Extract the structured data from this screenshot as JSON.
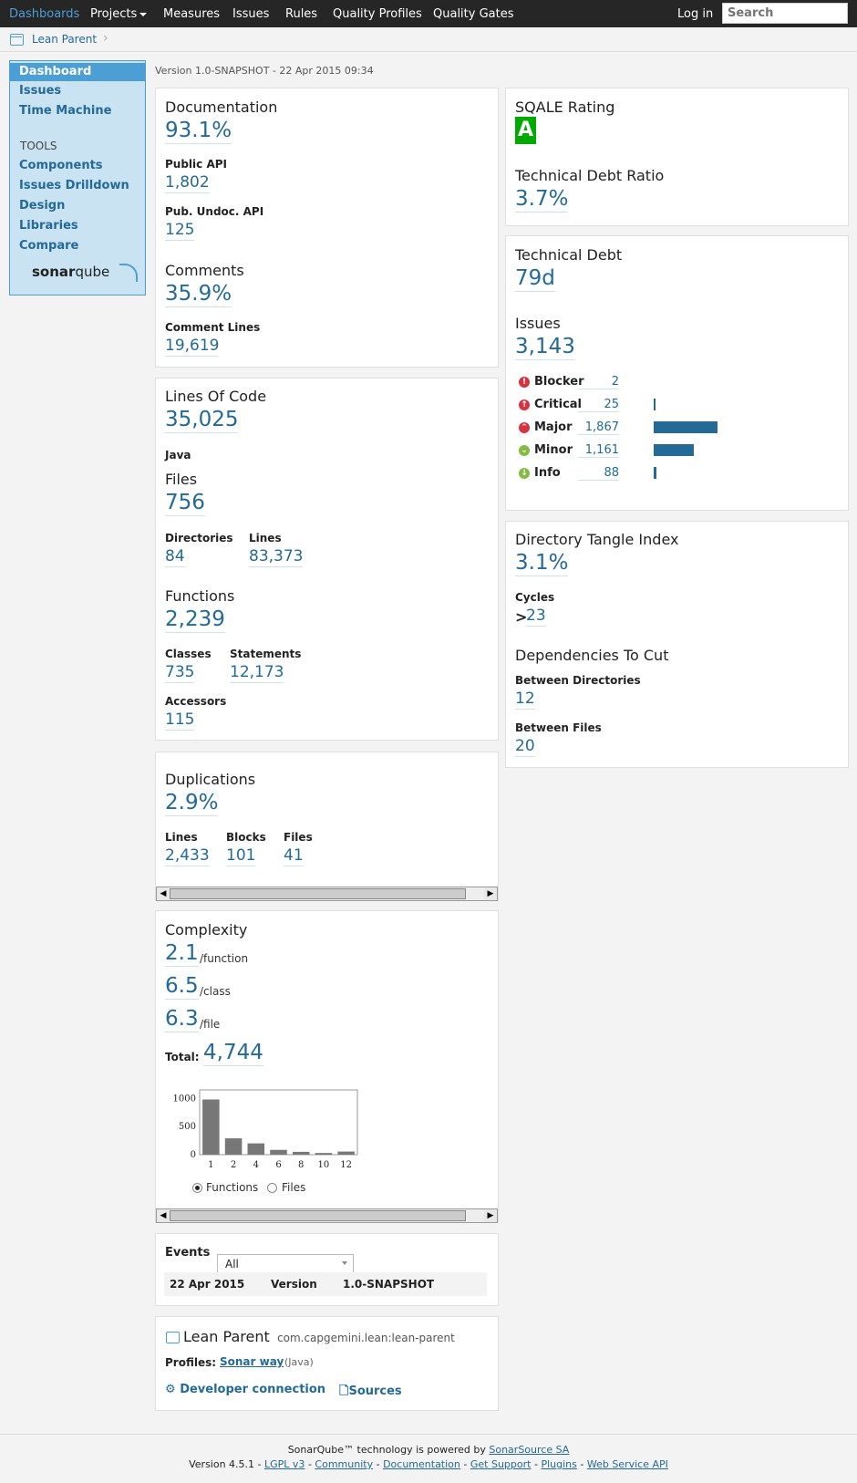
{
  "nav": {
    "dashboards": "Dashboards",
    "projects": "Projects",
    "measures": "Measures",
    "issues": "Issues",
    "rules": "Rules",
    "quality_profiles": "Quality Profiles",
    "quality_gates": "Quality Gates",
    "login": "Log in",
    "search_placeholder": "Search"
  },
  "breadcrumb": {
    "project": "Lean Parent"
  },
  "sidebar": {
    "dashboard": "Dashboard",
    "issues": "Issues",
    "time_machine": "Time Machine",
    "tools_heading": "TOOLS",
    "components": "Components",
    "issues_drilldown": "Issues Drilldown",
    "design": "Design",
    "libraries": "Libraries",
    "compare": "Compare",
    "logo_bold": "sonar",
    "logo_light": "qube"
  },
  "version_line": "Version 1.0-SNAPSHOT - 22 Apr 2015 09:34",
  "documentation": {
    "title": "Documentation",
    "value": "93.1%",
    "public_api_label": "Public API",
    "public_api": "1,802",
    "undoc_label": "Pub. Undoc. API",
    "undoc": "125",
    "comments_title": "Comments",
    "comments": "35.9%",
    "comment_lines_label": "Comment Lines",
    "comment_lines": "19,619"
  },
  "size": {
    "loc_title": "Lines Of Code",
    "loc": "35,025",
    "language": "Java",
    "files_title": "Files",
    "files": "756",
    "directories_label": "Directories",
    "directories": "84",
    "lines_label": "Lines",
    "lines": "83,373",
    "functions_title": "Functions",
    "functions": "2,239",
    "classes_label": "Classes",
    "classes": "735",
    "statements_label": "Statements",
    "statements": "12,173",
    "accessors_label": "Accessors",
    "accessors": "115"
  },
  "duplications": {
    "title": "Duplications",
    "value": "2.9%",
    "lines_label": "Lines",
    "lines": "2,433",
    "blocks_label": "Blocks",
    "blocks": "101",
    "files_label": "Files",
    "files": "41"
  },
  "complexity": {
    "title": "Complexity",
    "per_function": "2.1",
    "per_function_unit": "/function",
    "per_class": "6.5",
    "per_class_unit": "/class",
    "per_file": "6.3",
    "per_file_unit": "/file",
    "total_label": "Total:",
    "total": "4,744",
    "radio_functions": "Functions",
    "radio_files": "Files",
    "selected": "Functions"
  },
  "chart_data": {
    "type": "bar",
    "categories": [
      "1",
      "2",
      "4",
      "6",
      "8",
      "10",
      "12"
    ],
    "values": [
      980,
      290,
      200,
      85,
      50,
      30,
      55
    ],
    "ylim": [
      0,
      1150
    ],
    "yticks": [
      "1000",
      "500",
      "0"
    ],
    "grid": false,
    "bar_color": "#777777"
  },
  "events": {
    "label": "Events",
    "filter": "All",
    "rows": [
      {
        "date": "22 Apr 2015",
        "type": "Version",
        "name": "1.0-SNAPSHOT"
      }
    ]
  },
  "project_info": {
    "name": "Lean Parent",
    "key": "com.capgemini.lean:lean-parent",
    "profiles_label": "Profiles:",
    "profile": "Sonar way",
    "profile_lang": "(Java)",
    "dev_connection": "Developer connection",
    "sources": "Sources"
  },
  "sqale": {
    "title": "SQALE Rating",
    "rating": "A",
    "rating_color": "#00aa00",
    "ratio_title": "Technical Debt Ratio",
    "ratio": "3.7%"
  },
  "debt": {
    "title": "Technical Debt",
    "value": "79d",
    "issues_title": "Issues",
    "issues": "3,143",
    "severities": [
      {
        "name": "Blocker",
        "count": "2",
        "value": 2,
        "icon": "blocker-icon",
        "color": "#d4333f"
      },
      {
        "name": "Critical",
        "count": "25",
        "value": 25,
        "icon": "critical-icon",
        "color": "#d4333f"
      },
      {
        "name": "Major",
        "count": "1,867",
        "value": 1867,
        "icon": "major-icon",
        "color": "#d4333f"
      },
      {
        "name": "Minor",
        "count": "1,161",
        "value": 1161,
        "icon": "minor-icon",
        "color": "#85bb43"
      },
      {
        "name": "Info",
        "count": "88",
        "value": 88,
        "icon": "info-icon",
        "color": "#85bb43"
      }
    ]
  },
  "tangle": {
    "title": "Directory Tangle Index",
    "value": "3.1%",
    "cycles_label": "Cycles",
    "cycles_prefix": ">",
    "cycles": "23",
    "deps_title": "Dependencies To Cut",
    "between_dirs_label": "Between Directories",
    "between_dirs": "12",
    "between_files_label": "Between Files",
    "between_files": "20"
  },
  "footer": {
    "powered": "SonarQube™ technology is powered by",
    "company": "SonarSource SA",
    "version": "Version 4.5.1 -",
    "links": [
      "LGPL v3",
      "Community",
      "Documentation",
      "Get Support",
      "Plugins",
      "Web Service API"
    ],
    "sep": "-"
  }
}
